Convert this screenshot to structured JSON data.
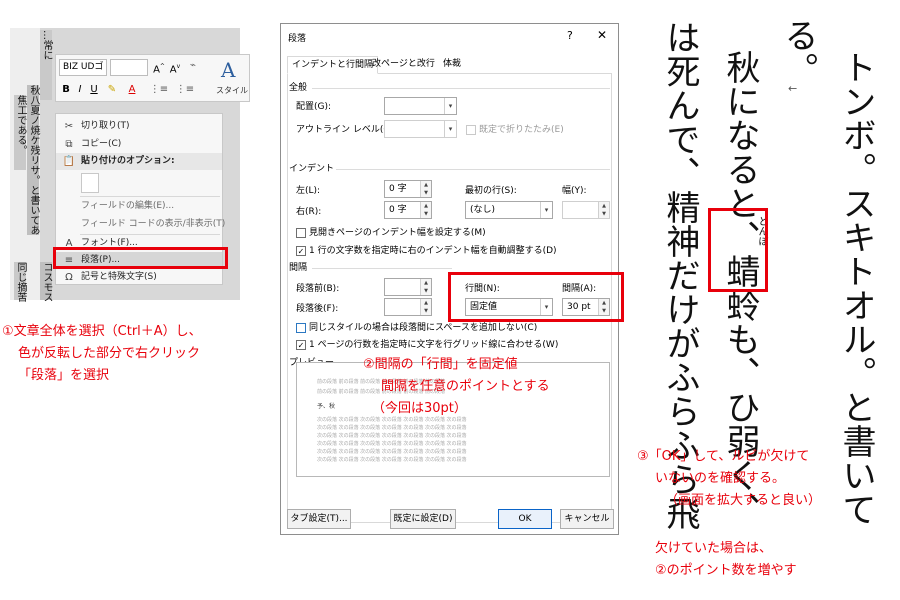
{
  "document": {
    "columns": [
      "…常に",
      "秋八夏ノ焼ケ残リサ。と書いてあ",
      "焦工である。",
      "同じ摘苦",
      "コスモス"
    ]
  },
  "mini_toolbar": {
    "font_name": "BIZ UDゴ",
    "font_size": "",
    "bold": "B",
    "italic": "I",
    "underline": "U",
    "style_icon_letter": "A",
    "style_label": "スタイル"
  },
  "context_menu": {
    "items": {
      "cut": "切り取り(T)",
      "copy": "コピー(C)",
      "paste_options": "貼り付けのオプション:",
      "edit_field": "フィールドの編集(E)...",
      "toggle_field_code": "フィールド コードの表示/非表示(T)",
      "font": "フォント(F)...",
      "paragraph": "段落(P)...",
      "symbols": "記号と特殊文字(S)"
    }
  },
  "annotation_1": [
    "①文章全体を選択（Ctrl＋A）し、",
    "色が反転した部分で右クリック",
    "「段落」を選択"
  ],
  "annotation_2": [
    "②間隔の「行間」を固定値",
    "間隔を任意のポイントとする",
    "（今回は30pt）"
  ],
  "annotation_3": [
    "③「OK」して、ルビが欠けて",
    "いないのを確認する。",
    "（画面を拡大すると良い）"
  ],
  "annotation_4": [
    "欠けていた場合は、",
    "②のポイント数を増やす"
  ],
  "dialog": {
    "title": "段落",
    "help": "?",
    "close": "✕",
    "tabs": [
      "インデントと行間隔",
      "改ページと改行",
      "体裁"
    ],
    "general": {
      "section": "全般",
      "alignment_label": "配置(G):",
      "alignment_value": "",
      "outline_label": "アウトライン レベル(O):",
      "outline_value": "",
      "collapsed_label": "既定で折りたたみ(E)"
    },
    "indent": {
      "section": "インデント",
      "left_label": "左(L):",
      "left_value": "0 字",
      "right_label": "右(R):",
      "right_value": "0 字",
      "first_line_label": "最初の行(S):",
      "first_line_value": "(なし)",
      "width_label": "幅(Y):",
      "width_value": "",
      "mirror_label": "見開きページのインデント幅を設定する(M)",
      "auto_adjust_label": "1 行の文字数を指定時に右のインデント幅を自動調整する(D)"
    },
    "spacing": {
      "section": "間隔",
      "before_label": "段落前(B):",
      "before_value": "",
      "after_label": "段落後(F):",
      "after_value": "",
      "line_spacing_label": "行間(N):",
      "line_spacing_value": "固定値",
      "at_label": "間隔(A):",
      "at_value": "30 pt",
      "no_space_label": "同じスタイルの場合は段落間にスペースを追加しない(C)",
      "snap_grid_label": "1 ページの行数を指定時に文字を行グリッド線に合わせる(W)"
    },
    "preview_label": "プレビュー",
    "preview_sample": "予、秋",
    "preview_filler": "前の段落 前の段落 前の段落 前の段落 前の段落 前の段落",
    "preview_filler_after": "次の段落 次の段落 次の段落 次の段落 次の段落 次の段落 次の段落",
    "buttons": {
      "tabs": "タブ設定(T)...",
      "default": "既定に設定(D)",
      "ok": "OK",
      "cancel": "キャンセル"
    }
  },
  "vertical_text": {
    "col1": "トンボ。スキトオル。と書いて",
    "col2": "る。",
    "col3_before": "秋になると、",
    "col3_kanji": "蜻蛉",
    "col3_after": "も、ひ弱く、",
    "col3_ruby": "とんぼ",
    "col4": "は死んで、精神だけがふらふら飛",
    "arrow": "←"
  },
  "colors": {
    "accent_red": "#e8000b",
    "ok_blue": "#0a64c8"
  }
}
